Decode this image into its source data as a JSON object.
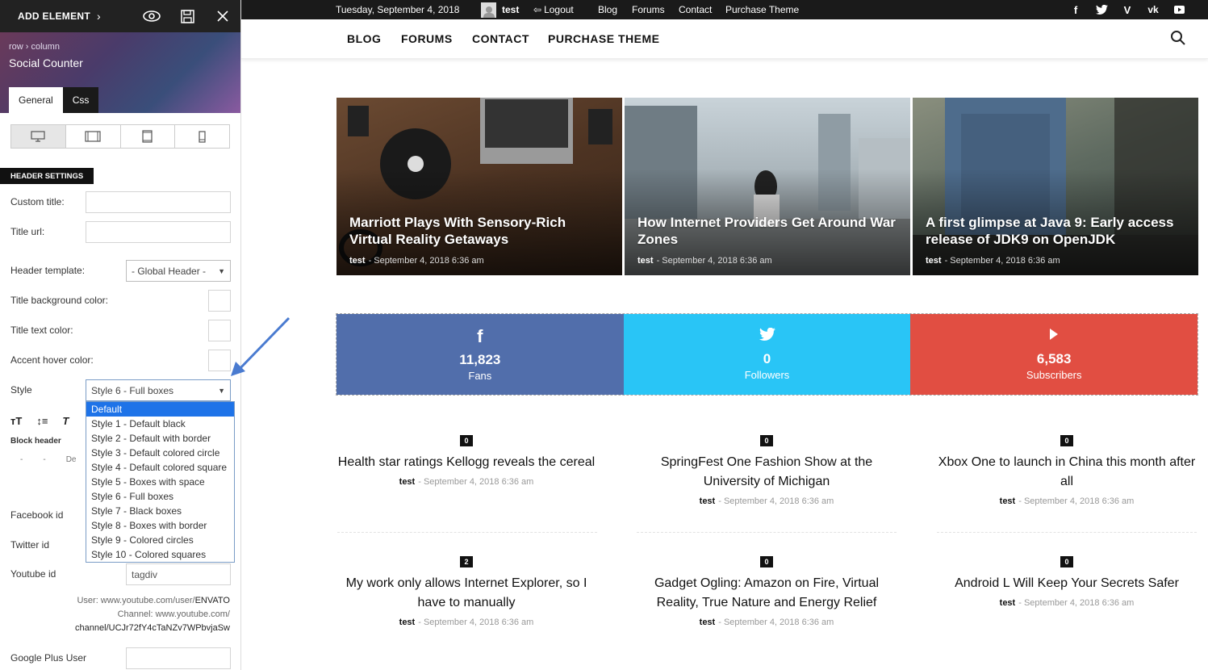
{
  "panel": {
    "add_element": "ADD ELEMENT",
    "breadcrumb": "row › column",
    "title": "Social Counter",
    "tabs": [
      "General",
      "Css"
    ],
    "section": "HEADER SETTINGS",
    "fields": {
      "custom_title": {
        "label": "Custom title:",
        "value": ""
      },
      "title_url": {
        "label": "Title url:",
        "value": ""
      },
      "header_template": {
        "label": "Header template:",
        "value": "- Global Header -"
      },
      "title_bg_color": {
        "label": "Title background color:"
      },
      "title_text_color": {
        "label": "Title text color:"
      },
      "accent_hover_color": {
        "label": "Accent hover color:"
      },
      "style": {
        "label": "Style",
        "value": "Style 6 - Full boxes"
      },
      "block_header": "Block header",
      "block_header_dashes": [
        "-",
        "-",
        "De"
      ],
      "facebook_id": {
        "label": "Facebook id",
        "value": ""
      },
      "twitter_id": {
        "label": "Twitter id",
        "value": ""
      },
      "youtube_id": {
        "label": "Youtube id",
        "value": "tagdiv"
      },
      "youtube_note1": "User: www.youtube.com/user/",
      "youtube_note1_b": "ENVATO",
      "youtube_note2": "Channel: www.youtube.com/",
      "youtube_note3": "channel/UCJr72fY4cTaNZv7WPbvjaSw",
      "google_plus": {
        "label": "Google Plus User",
        "value": ""
      }
    },
    "style_options": [
      "Default",
      "Style 1 - Default black",
      "Style 2 - Default with border",
      "Style 3 - Default colored circle",
      "Style 4 - Default colored square",
      "Style 5 - Boxes with space",
      "Style 6 - Full boxes",
      "Style 7 - Black boxes",
      "Style 8 - Boxes with border",
      "Style 9 - Colored circles",
      "Style 10 - Colored squares"
    ],
    "highlighted_option": "Default"
  },
  "topbar": {
    "date": "Tuesday, September 4, 2018",
    "user": "test",
    "logout": "Logout",
    "links": [
      "Blog",
      "Forums",
      "Contact",
      "Purchase Theme"
    ],
    "social_icons": [
      "facebook-icon",
      "twitter-icon",
      "vimeo-icon",
      "vk-icon",
      "youtube-icon"
    ]
  },
  "nav": {
    "items": [
      "BLOG",
      "FORUMS",
      "CONTACT",
      "PURCHASE THEME"
    ]
  },
  "featured": [
    {
      "title": "Marriott Plays With Sensory-Rich Virtual Reality Getaways",
      "author": "test",
      "date": "September 4, 2018 6:36 am"
    },
    {
      "title": "How Internet Providers Get Around War Zones",
      "author": "test",
      "date": "September 4, 2018 6:36 am"
    },
    {
      "title": "A first glimpse at Java 9: Early access release of JDK9 on OpenJDK",
      "author": "test",
      "date": "September 4, 2018 6:36 am"
    }
  ],
  "social_counter": [
    {
      "network": "facebook",
      "count": "11,823",
      "label": "Fans",
      "color": "#516eab"
    },
    {
      "network": "twitter",
      "count": "0",
      "label": "Followers",
      "color": "#29c5f6"
    },
    {
      "network": "youtube",
      "count": "6,583",
      "label": "Subscribers",
      "color": "#e14e42"
    }
  ],
  "posts": [
    {
      "badge": "0",
      "title": "Health star ratings Kellogg reveals the cereal",
      "author": "test",
      "date": "September 4, 2018 6:36 am"
    },
    {
      "badge": "0",
      "title": "SpringFest One Fashion Show at the University of Michigan",
      "author": "test",
      "date": "September 4, 2018 6:36 am"
    },
    {
      "badge": "0",
      "title": "Xbox One to launch in China this month after all",
      "author": "test",
      "date": "September 4, 2018 6:36 am"
    },
    {
      "badge": "2",
      "title": "My work only allows Internet Explorer, so I have to manually",
      "author": "test",
      "date": "September 4, 2018 6:36 am"
    },
    {
      "badge": "0",
      "title": "Gadget Ogling: Amazon on Fire, Virtual Reality, True Nature and Energy Relief",
      "author": "test",
      "date": "September 4, 2018 6:36 am"
    },
    {
      "badge": "0",
      "title": "Android L Will Keep Your Secrets Safer",
      "author": "test",
      "date": "September 4, 2018 6:36 am"
    }
  ],
  "sep": "-"
}
